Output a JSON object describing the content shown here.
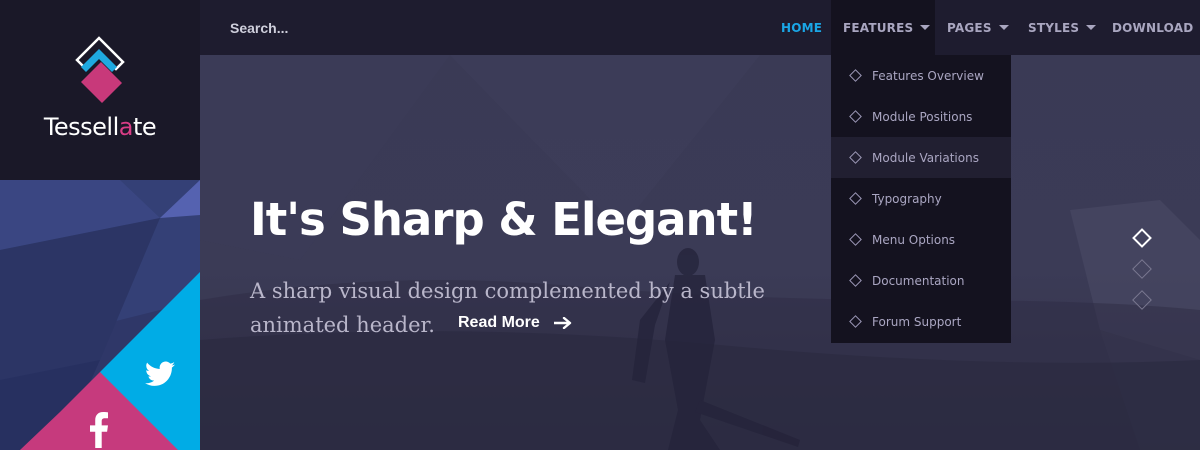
{
  "brand": {
    "name_before": "Tessell",
    "name_accent": "a",
    "name_after": "te",
    "accent_color": "#d93d86",
    "mark_colors": [
      "#ffffff",
      "#1fa9e0",
      "#c8397a"
    ]
  },
  "search": {
    "placeholder": "Search..."
  },
  "nav": {
    "items": [
      {
        "label": "HOME",
        "active": true
      },
      {
        "label": "FEATURES",
        "has_dropdown": true,
        "open": true
      },
      {
        "label": "PAGES",
        "has_dropdown": true
      },
      {
        "label": "STYLES",
        "has_dropdown": true
      },
      {
        "label": "DOWNLOAD"
      }
    ],
    "active_color": "#1aa6e6"
  },
  "dropdown": {
    "items": [
      {
        "label": "Features Overview"
      },
      {
        "label": "Module Positions"
      },
      {
        "label": "Module Variations",
        "highlighted": true
      },
      {
        "label": "Typography"
      },
      {
        "label": "Menu Options"
      },
      {
        "label": "Documentation"
      },
      {
        "label": "Forum Support"
      }
    ]
  },
  "hero": {
    "headline": "It's Sharp & Elegant!",
    "subtext": "A sharp visual design complemented by a subtle animated header.",
    "cta_label": "Read More",
    "cta_icon": "arrow-right-icon"
  },
  "slider": {
    "total": 3,
    "active_index": 0
  },
  "social": [
    {
      "network": "twitter",
      "icon": "twitter-icon",
      "color": "#00ace6"
    },
    {
      "network": "facebook",
      "icon": "facebook-icon",
      "color": "#c63a7d"
    }
  ]
}
